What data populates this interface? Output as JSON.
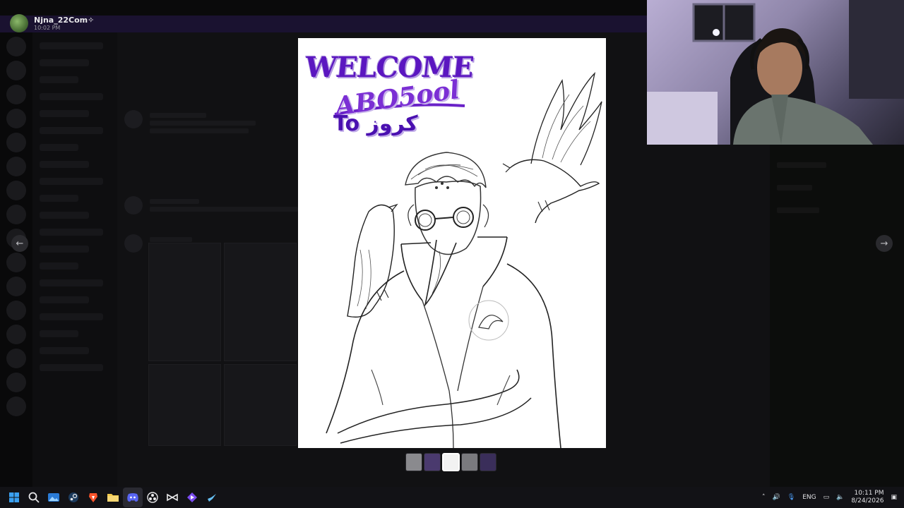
{
  "header": {
    "username": "Njna_22Com✧",
    "timestamp": "10:02 PM"
  },
  "image": {
    "welcome": "WELCOME",
    "name": "ABO5ool",
    "to": "To كروز"
  },
  "taskbar": {
    "language": "ENG",
    "time": "10:11 PM",
    "date": "8/24/2026",
    "icons": [
      "windows-start-icon",
      "search-icon",
      "photos-icon",
      "steam-icon",
      "brave-icon",
      "file-explorer-icon",
      "discord-icon",
      "obs-icon",
      "capcut-icon",
      "vpn-icon",
      "steam-icon-2"
    ]
  },
  "colors": {
    "accent_purple": "#5b16c0",
    "discord_blue": "#5865f2"
  }
}
